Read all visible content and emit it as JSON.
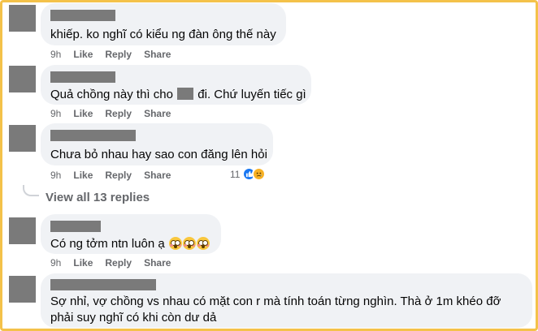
{
  "comments": [
    {
      "text": "khiếp. ko nghĩ có kiểu ng đàn ông thế này",
      "time": "9h",
      "like": "Like",
      "reply": "Reply",
      "share": "Share"
    },
    {
      "text_before": "Quả chồng này thì cho",
      "text_after": "đi. Chứ luyến tiếc gì",
      "time": "9h",
      "like": "Like",
      "reply": "Reply",
      "share": "Share"
    },
    {
      "text": "Chưa bỏ nhau hay sao con đăng lên hỏi",
      "time": "9h",
      "like": "Like",
      "reply": "Reply",
      "share": "Share",
      "reaction_count": "11",
      "reactions": [
        "like-icon",
        "sad-icon"
      ],
      "view_replies": "View all 13 replies"
    },
    {
      "text": "Có ng tởm ntn luôn ạ",
      "emojis": [
        "flushed-face-icon",
        "flushed-face-icon",
        "flushed-face-icon"
      ],
      "time": "9h",
      "like": "Like",
      "reply": "Reply",
      "share": "Share"
    },
    {
      "text": "Sợ nhỉ, vợ chồng vs nhau có mặt con r mà tính toán từng nghìn. Thà ở 1m khéo đỡ phải suy nghĩ có khi còn dư dả"
    }
  ],
  "colors": {
    "bubble": "#f0f2f5",
    "action_text": "#65676b",
    "like_blue": "#1877f2",
    "frame": "#f4c24a",
    "redaction": "#7a7a7a"
  }
}
